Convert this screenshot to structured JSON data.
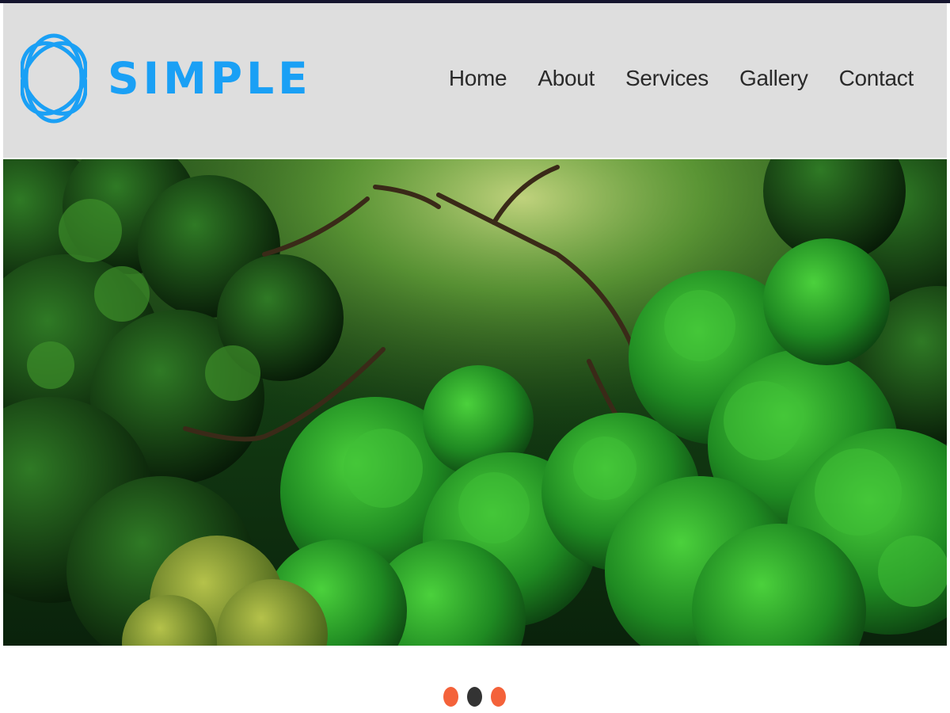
{
  "brand": {
    "name": "SIMPLE",
    "color": "#1aa0f5",
    "logo_icon": "interlaced-orbit-icon"
  },
  "nav": {
    "items": [
      {
        "label": "Home"
      },
      {
        "label": "About"
      },
      {
        "label": "Services"
      },
      {
        "label": "Gallery"
      },
      {
        "label": "Contact"
      }
    ]
  },
  "hero": {
    "image": "green forest canopy with misty light",
    "colors": {
      "dark": "#071a08",
      "mid": "#1f7a1c",
      "bright": "#5fcf3c",
      "mist": "#b7d06a"
    }
  },
  "slider": {
    "slide_count": 3,
    "active_index": 1,
    "colors": {
      "active": "#333333",
      "inactive": "#f4623a"
    }
  }
}
